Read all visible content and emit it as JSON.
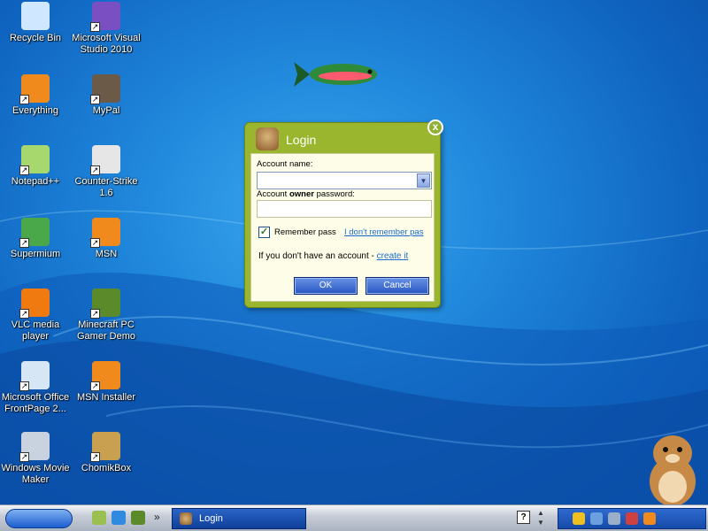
{
  "desktop": {
    "icons": [
      {
        "label": "Recycle Bin",
        "icon": "recycle-bin-icon",
        "color": "#cfe8ff"
      },
      {
        "label": "Microsoft Visual Studio 2010",
        "icon": "visual-studio-icon",
        "color": "#7a4fc2"
      },
      {
        "label": "Everything",
        "icon": "everything-search-icon",
        "color": "#f08a1c"
      },
      {
        "label": "MyPal",
        "icon": "mypal-raccoon-icon",
        "color": "#6b5a48"
      },
      {
        "label": "Notepad++",
        "icon": "notepad-plus-plus-icon",
        "color": "#a6d86e"
      },
      {
        "label": "Counter-Strike 1.6",
        "icon": "counter-strike-icon",
        "color": "#e6e6e6"
      },
      {
        "label": "Supermium",
        "icon": "supermium-icon",
        "color": "#4aa84a"
      },
      {
        "label": "MSN",
        "icon": "msn-butterfly-icon",
        "color": "#f08a1c"
      },
      {
        "label": "VLC media player",
        "icon": "vlc-cone-icon",
        "color": "#f07a10"
      },
      {
        "label": "Minecraft PC Gamer Demo",
        "icon": "minecraft-grass-icon",
        "color": "#5a8a2a"
      },
      {
        "label": "Microsoft Office FrontPage 2...",
        "icon": "frontpage-icon",
        "color": "#d7e6f5"
      },
      {
        "label": "MSN Installer",
        "icon": "msn-installer-icon",
        "color": "#f08a1c"
      },
      {
        "label": "Windows Movie Maker",
        "icon": "movie-maker-icon",
        "color": "#c9d3e0"
      },
      {
        "label": "ChomikBox",
        "icon": "chomikbox-icon",
        "color": "#c8a050"
      }
    ]
  },
  "dialog": {
    "title": "Login",
    "close_glyph": "x",
    "account_name_label": "Account name:",
    "password_label_pre": "Account ",
    "password_label_bold": "owner",
    "password_label_post": " password:",
    "account_name_value": "",
    "password_value": "",
    "remember_label": "Remember passw",
    "remember_checked": true,
    "forgot_link": "I don't remember pas",
    "no_account_text": "If you don't have an account - ",
    "create_link": "create it",
    "ok_label": "OK",
    "cancel_label": "Cancel",
    "accent": "#9ab62e"
  },
  "taskbar": {
    "overflow_glyph": "»",
    "task_label": "Login",
    "help_glyph": "?",
    "updown_glyph_up": "▲",
    "updown_glyph_down": "▼"
  }
}
